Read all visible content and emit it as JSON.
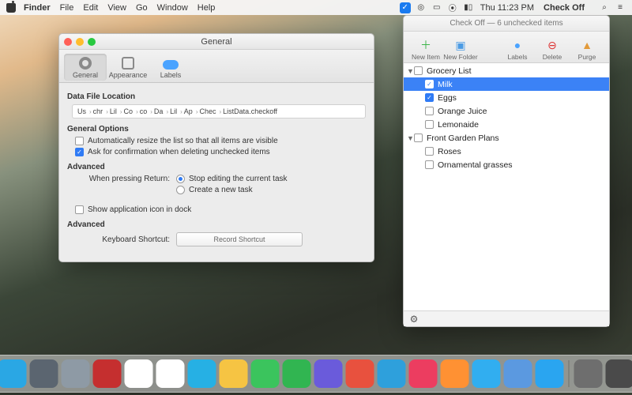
{
  "menubar": {
    "app": "Finder",
    "items": [
      "File",
      "Edit",
      "View",
      "Go",
      "Window",
      "Help"
    ],
    "clock": "Thu 11:23 PM",
    "right_app": "Check Off"
  },
  "prefs": {
    "title": "General",
    "tabs": {
      "general": "General",
      "appearance": "Appearance",
      "labels": "Labels"
    },
    "sections": {
      "data_file": "Data File Location",
      "general_options": "General Options",
      "advanced": "Advanced",
      "advanced2": "Advanced"
    },
    "path": [
      "Us",
      "chr",
      "Lil",
      "Co",
      "co",
      "Da",
      "Lil",
      "Ap",
      "Chec",
      "ListData.checkoff"
    ],
    "auto_resize": "Automatically resize the list so that all items are visible",
    "ask_confirm": "Ask for confirmation when deleting unchecked items",
    "return_label": "When pressing Return:",
    "return_stop": "Stop editing the current task",
    "return_new": "Create a new task",
    "show_dock": "Show application icon in dock",
    "shortcut_label": "Keyboard Shortcut:",
    "shortcut_btn": "Record Shortcut"
  },
  "panel": {
    "title": "Check Off — 6 unchecked items",
    "toolbar": {
      "new_item": "New Item",
      "new_folder": "New Folder",
      "labels": "Labels",
      "delete": "Delete",
      "purge": "Purge"
    },
    "groups": [
      {
        "name": "Grocery List",
        "expanded": true,
        "checked": false,
        "items": [
          {
            "name": "Milk",
            "checked": true,
            "selected": true
          },
          {
            "name": "Eggs",
            "checked": true
          },
          {
            "name": "Orange Juice",
            "checked": false
          },
          {
            "name": "Lemonaide",
            "checked": false
          }
        ]
      },
      {
        "name": "Front Garden Plans",
        "expanded": true,
        "checked": false,
        "items": [
          {
            "name": "Roses",
            "checked": false
          },
          {
            "name": "Ornamental grasses",
            "checked": false
          }
        ]
      }
    ]
  },
  "dock": {
    "colors": [
      "#2aa7e4",
      "#5b6570",
      "#8e9aa5",
      "#c52f2f",
      "#ffffff",
      "#ffffff",
      "#26b0e4",
      "#f6c443",
      "#3bc45d",
      "#31b551",
      "#6a5bdb",
      "#e8513e",
      "#2ea0dc",
      "#ec3d60",
      "#ff9133",
      "#31aef0",
      "#5b99e0",
      "#2aa5f0",
      "#6e6e6e",
      "#4a4a4a"
    ]
  }
}
